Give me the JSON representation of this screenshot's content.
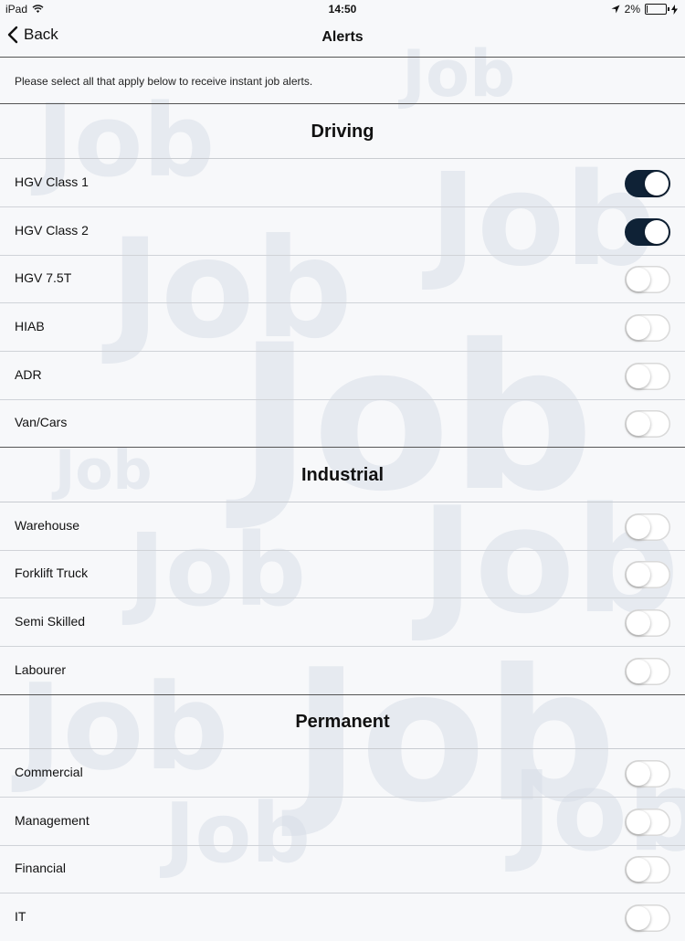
{
  "status_bar": {
    "device": "iPad",
    "time": "14:50",
    "battery": "2%"
  },
  "nav": {
    "back_label": "Back",
    "title": "Alerts"
  },
  "intro": "Please select all that apply below to receive instant job alerts.",
  "watermark_text": "Job",
  "sections": [
    {
      "title": "Driving",
      "items": [
        {
          "label": "HGV Class 1",
          "on": true
        },
        {
          "label": "HGV Class 2",
          "on": true
        },
        {
          "label": "HGV 7.5T",
          "on": false
        },
        {
          "label": "HIAB",
          "on": false
        },
        {
          "label": "ADR",
          "on": false
        },
        {
          "label": "Van/Cars",
          "on": false
        }
      ]
    },
    {
      "title": "Industrial",
      "items": [
        {
          "label": "Warehouse",
          "on": false
        },
        {
          "label": "Forklift Truck",
          "on": false
        },
        {
          "label": "Semi Skilled",
          "on": false
        },
        {
          "label": "Labourer",
          "on": false
        }
      ]
    },
    {
      "title": "Permanent",
      "items": [
        {
          "label": "Commercial",
          "on": false
        },
        {
          "label": "Management",
          "on": false
        },
        {
          "label": "Financial",
          "on": false
        },
        {
          "label": "IT",
          "on": false
        }
      ]
    }
  ],
  "colors": {
    "toggle_on": "#0f2236",
    "toggle_off": "#ffffff",
    "watermark": "#d9dfe8"
  }
}
